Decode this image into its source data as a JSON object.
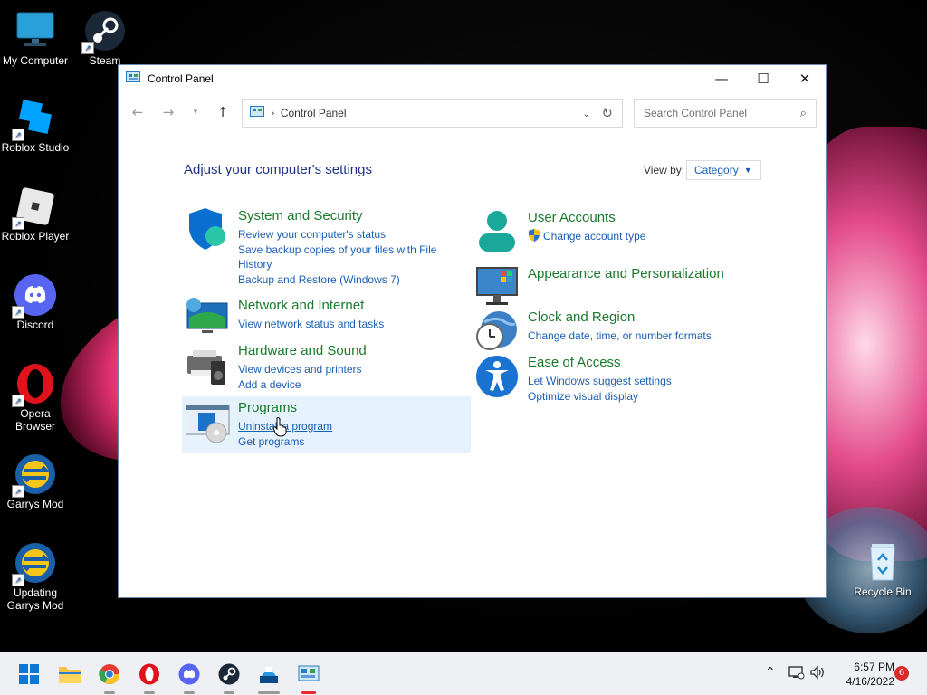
{
  "desktop": {
    "icons": [
      {
        "label": "My Computer"
      },
      {
        "label": "Steam"
      },
      {
        "label": "Roblox Studio"
      },
      {
        "label": "Roblox Player"
      },
      {
        "label": "Discord"
      },
      {
        "label": "Opera Browser"
      },
      {
        "label": "Garrys Mod"
      },
      {
        "label": "Updating Garrys Mod"
      },
      {
        "label": "Recycle Bin"
      }
    ]
  },
  "window": {
    "title": "Control Panel",
    "address": {
      "crumb": "Control Panel"
    },
    "search": {
      "placeholder": "Search Control Panel"
    },
    "heading": "Adjust your computer's settings",
    "view_by": {
      "label": "View by:",
      "value": "Category"
    },
    "categories": [
      {
        "title": "System and Security",
        "icon": "shield-icon",
        "links": [
          "Review your computer's status",
          "Save backup copies of your files with File History",
          "Backup and Restore (Windows 7)"
        ]
      },
      {
        "title": "Network and Internet",
        "icon": "globe-network-icon",
        "links": [
          "View network status and tasks"
        ]
      },
      {
        "title": "Hardware and Sound",
        "icon": "printer-speaker-icon",
        "links": [
          "View devices and printers",
          "Add a device"
        ]
      },
      {
        "title": "Programs",
        "icon": "programs-icon",
        "links": [
          "Uninstall a program",
          "Get programs"
        ]
      },
      {
        "title": "User Accounts",
        "icon": "user-icon",
        "links": [
          "Change account type"
        ]
      },
      {
        "title": "Appearance and Personalization",
        "icon": "monitor-icon",
        "links": []
      },
      {
        "title": "Clock and Region",
        "icon": "clock-globe-icon",
        "links": [
          "Change date, time, or number formats"
        ]
      },
      {
        "title": "Ease of Access",
        "icon": "accessibility-icon",
        "links": [
          "Let Windows suggest settings",
          "Optimize visual display"
        ]
      }
    ]
  },
  "taskbar": {
    "apps": [
      "start-icon",
      "file-explorer-icon",
      "chrome-icon",
      "opera-icon",
      "discord-icon",
      "steam-icon",
      "roblox-studio-icon",
      "control-panel-icon"
    ],
    "time": "6:57 PM",
    "date": "4/16/2022",
    "notifications": "6"
  },
  "colors": {
    "link": "#1a5fb4",
    "category_title": "#1a7a2c",
    "heading": "#1e3287",
    "highlight": "#e5f1fb"
  }
}
